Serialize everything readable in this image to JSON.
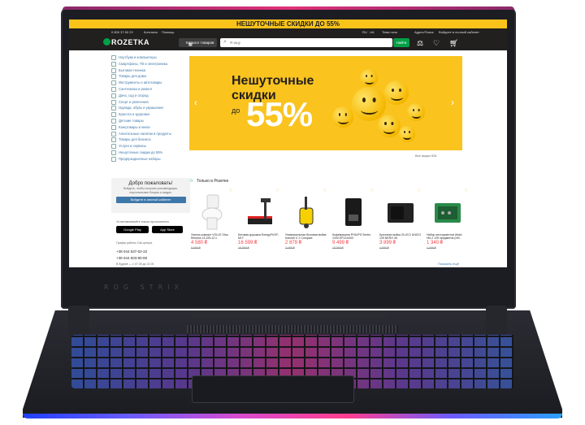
{
  "promo": {
    "text": "НЕШУТОЧНЫЕ СКИДКИ ДО 55%"
  },
  "topline": {
    "phone": "0 800 37 60 22",
    "contacts": "Контакты",
    "help": "Помощь",
    "lang_ru": "RU",
    "lang_ua": "UA",
    "night_mode": "Тема ночь",
    "express": "Адрес/Поиск",
    "green_ticket": "Будьте в зелёной рамке",
    "login": "Войдите в личный кабинет"
  },
  "header": {
    "logo": "ROZETKA",
    "catalog": "Каталог товаров",
    "search_placeholder": "Я ищу",
    "search_button": "Найти"
  },
  "sidebar": {
    "items": [
      "Ноутбуки и компьютеры",
      "Смартфоны, ТВ и электроника",
      "Бытовая техника",
      "Товары для дома",
      "Инструменты и автотовары",
      "Сантехника и ремонт",
      "Дача, сад и огород",
      "Спорт и увлечения",
      "Одежда, обувь и украшения",
      "Красота и здоровье",
      "Детские товары",
      "Канцтовары и книги",
      "Алкогольные напитки и продукты",
      "Товары для бизнеса",
      "Услуги и сервисы",
      "Нешуточные скидки до 55%",
      "Предпраздничные наборы"
    ]
  },
  "welcome": {
    "title": "Добро пожаловать!",
    "text": "Войдите, чтобы получать рекомендации, персональные бонусы и скидки.",
    "button": "Войдите в личный кабинет"
  },
  "apps": {
    "title": "Устанавливайте наши приложения",
    "google": "Google Play",
    "apple": "App Store"
  },
  "contacts": {
    "hours_label": "График работы Call-центра",
    "phone1": "+38 044 537-02-22",
    "phone2": "+38 044 503-80-80",
    "schedule": "В будние — с 07:45 до 21:00"
  },
  "banner": {
    "line1": "Нешуточные",
    "line2": "скидки",
    "prefix": "до",
    "value": "55%",
    "all": "Все акции  534"
  },
  "products_section": {
    "title": "Только в Розетке",
    "show_more": "Показать ещё"
  },
  "products": [
    {
      "name": "Унитаз-компакт VOLLE Olsa Rimless 13-225-12 с",
      "old": "5 999 ₴",
      "price": "4 580 ₴"
    },
    {
      "name": "Беговая дорожка EnergyFit EF-M1T",
      "old": "19 999 ₴",
      "price": "16 599 ₴"
    },
    {
      "name": "Универсальная бытовая мойка Karcher K 2 Compact",
      "old": "3 499 ₴",
      "price": "2 879 ₴"
    },
    {
      "name": "Кофемашина PHILIPS Series 1200 EP1224/00",
      "old": "15 999 ₴",
      "price": "9 499 ₴"
    },
    {
      "name": "Кухонная мойка ZLLECI UNICO 125 NERO 45",
      "old": "4 899 ₴",
      "price": "3 899 ₴"
    },
    {
      "name": "Набор инструментов Alloid НИ-2 125 предметов (НИ-",
      "old": "1 499 ₴",
      "price": "1 340 ₴"
    }
  ],
  "laptop": {
    "bezel_text": "ROG STRIX"
  }
}
